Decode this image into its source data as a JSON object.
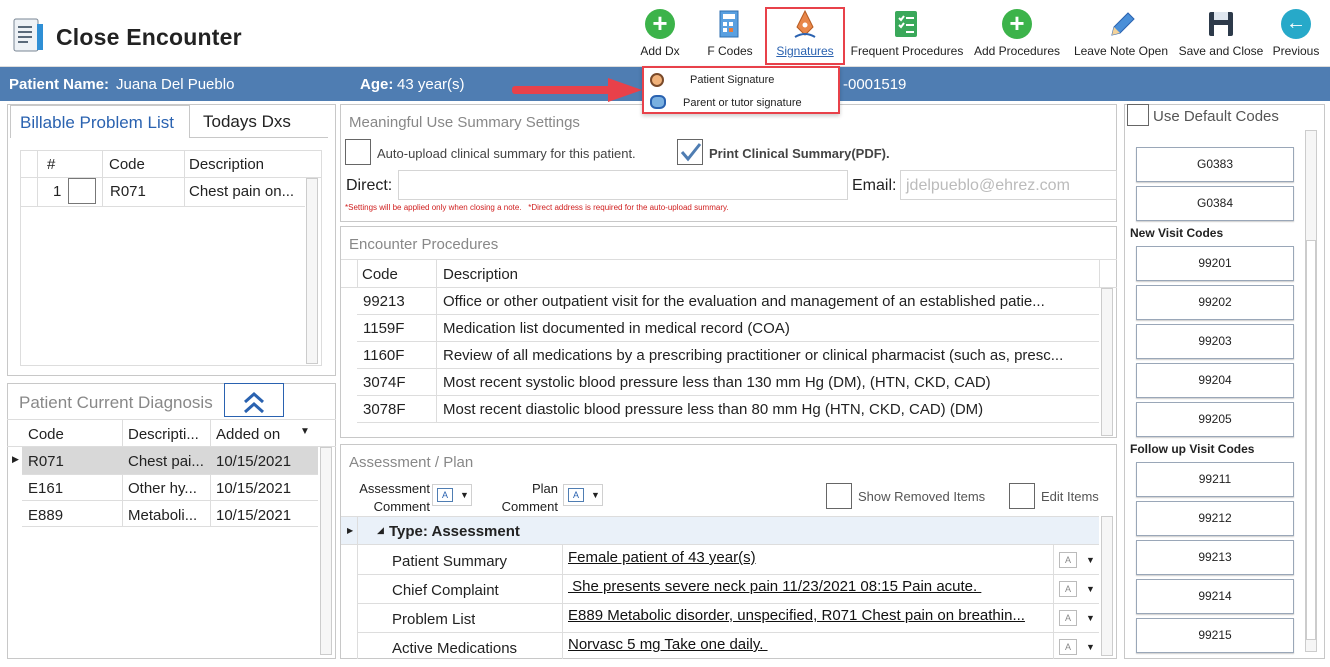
{
  "app": {
    "title": "Close Encounter"
  },
  "toolbar": {
    "add_dx": "Add Dx",
    "f_codes": "F Codes",
    "signatures": "Signatures",
    "frequent_procedures": "Frequent Procedures",
    "add_procedures": "Add Procedures",
    "leave_note_open": "Leave Note Open",
    "save_and_close": "Save and Close",
    "previous": "Previous"
  },
  "signatures_menu": {
    "items": [
      {
        "label": "Patient Signature"
      },
      {
        "label": "Parent or tutor signature"
      }
    ]
  },
  "patient_bar": {
    "name_label": "Patient Name:",
    "name_value": "Juana Del Pueblo",
    "age_label": "Age:",
    "age_value": "43 year(s)",
    "id_value": "-0001519"
  },
  "problem_tabs": {
    "billable": "Billable Problem List",
    "todays": "Todays Dxs"
  },
  "problem_grid": {
    "headers": {
      "num": "#",
      "code": "Code",
      "description": "Description"
    },
    "rows": [
      {
        "num": "1",
        "code": "R071",
        "description": "Chest pain on..."
      }
    ]
  },
  "current_dx": {
    "title": "Patient Current Diagnosis",
    "headers": {
      "code": "Code",
      "description": "Descripti...",
      "added": "Added on"
    },
    "rows": [
      {
        "code": "R071",
        "description": "Chest pai...",
        "added": "10/15/2021"
      },
      {
        "code": "E161",
        "description": "Other hy...",
        "added": "10/15/2021"
      },
      {
        "code": "E889",
        "description": "Metaboli...",
        "added": "10/15/2021"
      }
    ]
  },
  "mu": {
    "title": "Meaningful Use Summary Settings",
    "auto_upload": "Auto-upload clinical summary for this patient.",
    "print_summary": "Print Clinical Summary(PDF).",
    "direct_label": "Direct:",
    "direct_value": "",
    "email_label": "Email:",
    "email_placeholder": "jdelpueblo@ehrez.com",
    "note": "*Settings will be applied only when closing a note.   *Direct address is required for the auto-upload summary."
  },
  "procedures": {
    "title": "Encounter Procedures",
    "headers": {
      "code": "Code",
      "description": "Description"
    },
    "rows": [
      {
        "code": "99213",
        "description": "Office or other outpatient visit for the evaluation and management of an established patie..."
      },
      {
        "code": "1159F",
        "description": "Medication list documented in medical record (COA)"
      },
      {
        "code": "1160F",
        "description": "Review of all medications by a prescribing practitioner or clinical pharmacist (such as, presc..."
      },
      {
        "code": "3074F",
        "description": "Most recent systolic blood pressure less than 130 mm Hg (DM), (HTN, CKD, CAD)"
      },
      {
        "code": "3078F",
        "description": "Most recent diastolic blood pressure less than 80 mm Hg (HTN, CKD, CAD) (DM)"
      }
    ]
  },
  "assessment": {
    "title": "Assessment / Plan",
    "assessment_comment": "Assessment Comment",
    "plan_comment": "Plan Comment",
    "show_removed": "Show Removed Items",
    "edit_items": "Edit Items",
    "group": "Type: Assessment",
    "rows": [
      {
        "label": "Patient Summary",
        "value": "Female patient of 43 year(s)"
      },
      {
        "label": "Chief Complaint",
        "value": " She presents severe neck pain 11/23/2021 08:15 Pain acute. "
      },
      {
        "label": "Problem List",
        "value": "E889 Metabolic disorder, unspecified, R071 Chest pain on breathin..."
      },
      {
        "label": "Active Medications",
        "value": "Norvasc 5 mg Take one daily. "
      }
    ]
  },
  "codes": {
    "use_default": "Use Default Codes",
    "top": [
      "G0383",
      "G0384"
    ],
    "new_visit_label": "New Visit Codes",
    "new_visit": [
      "99201",
      "99202",
      "99203",
      "99204",
      "99205"
    ],
    "follow_up_label": "Follow up Visit Codes",
    "follow_up": [
      "99211",
      "99212",
      "99213",
      "99214",
      "99215"
    ]
  },
  "colors": {
    "accent": "#4f7db2",
    "highlight": "#e8414a",
    "green": "#3cb34a"
  }
}
